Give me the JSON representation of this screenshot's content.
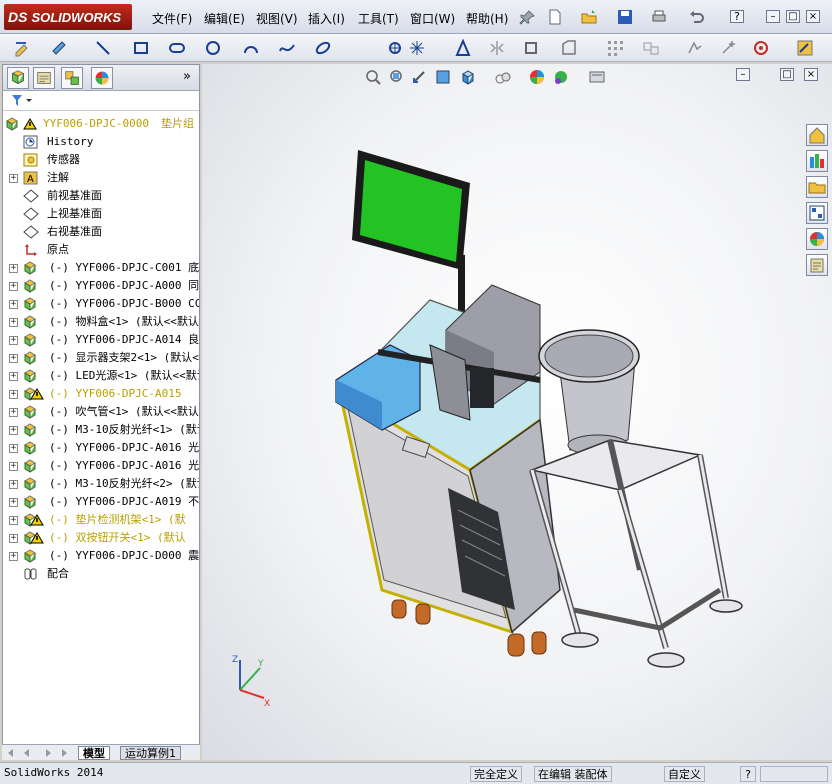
{
  "app": {
    "logo_text": "SOLIDWORKS",
    "logo_mark": "DS"
  },
  "menu": {
    "items": [
      "文件(F)",
      "编辑(E)",
      "视图(V)",
      "插入(I)",
      "工具(T)",
      "窗口(W)",
      "帮助(H)"
    ]
  },
  "window": {
    "minimize": "–",
    "restore": "□",
    "close": "×",
    "help": "?"
  },
  "panel": {
    "expand_label": "»",
    "root_label": "YYF006-DPJC-0000",
    "root_suffix": "垫片组",
    "items": [
      {
        "label": "History",
        "icon": "history-icon",
        "exp": false
      },
      {
        "label": "传感器",
        "icon": "sensor-icon",
        "exp": false
      },
      {
        "label": "注解",
        "icon": "annotation-icon",
        "exp": true
      },
      {
        "label": "前视基准面",
        "icon": "plane-icon",
        "exp": false
      },
      {
        "label": "上视基准面",
        "icon": "plane-icon",
        "exp": false
      },
      {
        "label": "右视基准面",
        "icon": "plane-icon",
        "exp": false
      },
      {
        "label": "原点",
        "icon": "origin-icon",
        "exp": false
      },
      {
        "label": "(-) YYF006-DPJC-C001   底",
        "icon": "assembly-icon",
        "exp": true
      },
      {
        "label": "(-) YYF006-DPJC-A000   同",
        "icon": "assembly-icon",
        "exp": true
      },
      {
        "label": "(-) YYF006-DPJC-B000   CC",
        "icon": "assembly-icon",
        "exp": true
      },
      {
        "label": "(-) 物料盒<1> (默认<<默认",
        "icon": "assembly-icon",
        "exp": true
      },
      {
        "label": "(-) YYF006-DPJC-A014   良",
        "icon": "assembly-icon",
        "exp": true
      },
      {
        "label": "(-) 显示器支架2<1> (默认<9",
        "icon": "assembly-icon",
        "exp": true
      },
      {
        "label": "(-) LED光源<1> (默认<<默认",
        "icon": "assembly-icon",
        "exp": true
      },
      {
        "label": "(-) YYF006-DPJC-A015",
        "icon": "assembly-warning-icon",
        "exp": true,
        "warn": true
      },
      {
        "label": "(-) 吹气管<1> (默认<<默认>",
        "icon": "assembly-icon",
        "exp": true
      },
      {
        "label": "(-) M3-10反射光纤<1> (默认",
        "icon": "assembly-icon",
        "exp": true
      },
      {
        "label": "(-) YYF006-DPJC-A016   光",
        "icon": "assembly-icon",
        "exp": true
      },
      {
        "label": "(-) YYF006-DPJC-A016   光",
        "icon": "assembly-icon",
        "exp": true
      },
      {
        "label": "(-) M3-10反射光纤<2> (默认",
        "icon": "assembly-icon",
        "exp": true
      },
      {
        "label": "(-) YYF006-DPJC-A019   不",
        "icon": "assembly-icon",
        "exp": true
      },
      {
        "label": "(-) 垫片检测机架<1> (默",
        "icon": "assembly-warning-icon",
        "exp": true,
        "warn": true
      },
      {
        "label": "(-) 双按钮开关<1> (默认",
        "icon": "assembly-warning-icon",
        "exp": true,
        "warn": true
      },
      {
        "label": "(-) YYF006-DPJC-D000   震",
        "icon": "assembly-icon",
        "exp": true
      },
      {
        "label": "配合",
        "icon": "mates-icon",
        "exp": false
      }
    ]
  },
  "tabs": {
    "model": "模型",
    "motion": "运动算例1"
  },
  "triad": {
    "x": "X",
    "y": "Y",
    "z": "Z"
  },
  "status": {
    "app": "SolidWorks 2014",
    "defined": "完全定义",
    "editing": "在编辑 装配体",
    "custom": "自定义",
    "help": "?"
  },
  "colors": {
    "accent": "#c42b1c",
    "screen": "#22c322",
    "frame": "#9a9aa6"
  }
}
